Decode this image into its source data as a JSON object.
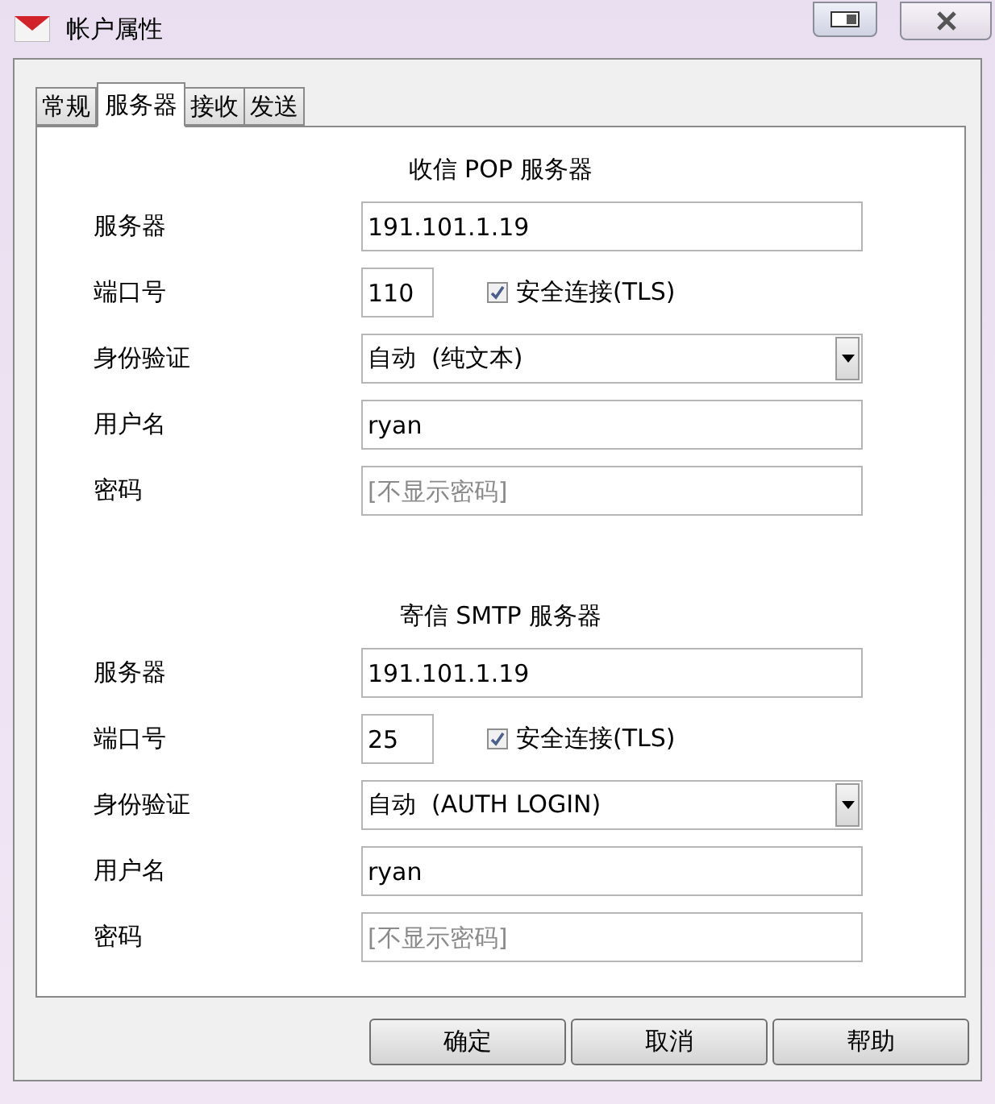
{
  "window": {
    "title": "帐户属性"
  },
  "tabs": [
    {
      "label": "常规",
      "selected": false
    },
    {
      "label": "服务器",
      "selected": true
    },
    {
      "label": "接收",
      "selected": false
    },
    {
      "label": "发送",
      "selected": false
    }
  ],
  "sections": [
    {
      "title": "收信 POP 服务器",
      "rows": [
        {
          "kind": "text",
          "label": "服务器",
          "value": "191.101.1.19"
        },
        {
          "kind": "port",
          "label": "端口号",
          "value": "110",
          "checkbox": {
            "label": "安全连接(TLS)",
            "checked": true
          }
        },
        {
          "kind": "select",
          "label": "身份验证",
          "value": "自动  (纯文本)"
        },
        {
          "kind": "text",
          "label": "用户名",
          "value": "ryan"
        },
        {
          "kind": "password",
          "label": "密码",
          "placeholder": "[不显示密码]"
        }
      ]
    },
    {
      "title": "寄信 SMTP 服务器",
      "rows": [
        {
          "kind": "text",
          "label": "服务器",
          "value": "191.101.1.19"
        },
        {
          "kind": "port",
          "label": "端口号",
          "value": "25",
          "checkbox": {
            "label": "安全连接(TLS)",
            "checked": true
          }
        },
        {
          "kind": "select",
          "label": "身份验证",
          "value": "自动  (AUTH LOGIN)"
        },
        {
          "kind": "text",
          "label": "用户名",
          "value": "ryan"
        },
        {
          "kind": "password",
          "label": "密码",
          "placeholder": "[不显示密码]"
        }
      ]
    }
  ],
  "buttons": [
    "确定",
    "取消",
    "帮助"
  ]
}
